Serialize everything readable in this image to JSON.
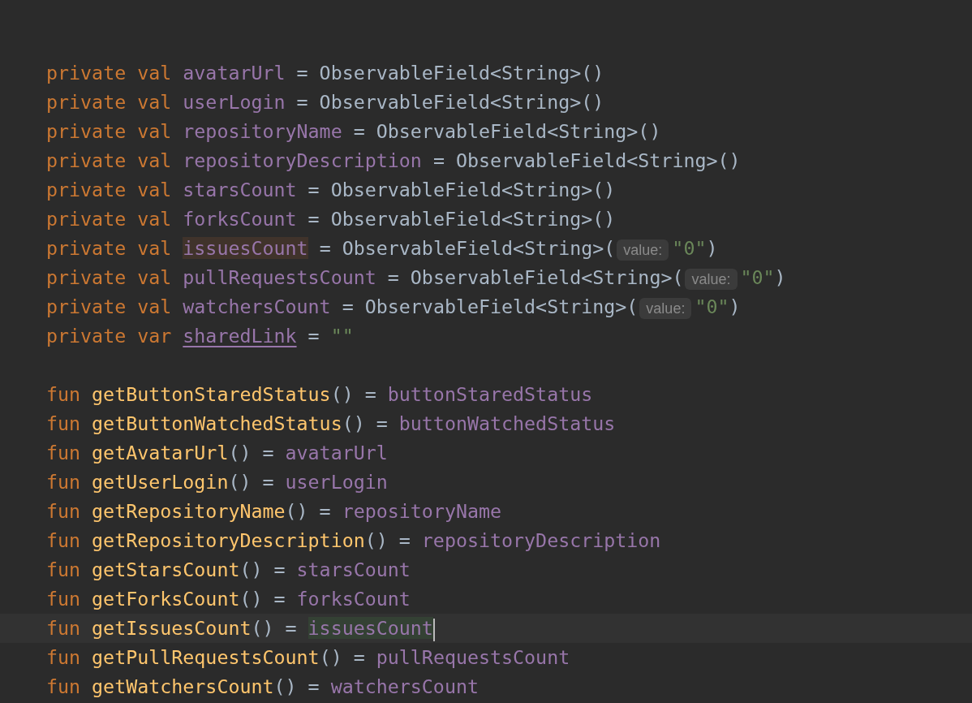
{
  "editor": {
    "blocks": [
      {
        "lines": [
          {
            "cursor": false,
            "tokens": [
              {
                "kind": "keyword",
                "t": "private val"
              },
              {
                "kind": "property",
                "t": "avatarUrl"
              },
              {
                "kind": "plain",
                "t": "= ObservableField<String>()"
              }
            ]
          },
          {
            "cursor": false,
            "tokens": [
              {
                "kind": "keyword",
                "t": "private val"
              },
              {
                "kind": "property",
                "t": "userLogin"
              },
              {
                "kind": "plain",
                "t": "= ObservableField<String>()"
              }
            ]
          },
          {
            "cursor": false,
            "tokens": [
              {
                "kind": "keyword",
                "t": "private val"
              },
              {
                "kind": "property",
                "t": "repositoryName"
              },
              {
                "kind": "plain",
                "t": "= ObservableField<String>()"
              }
            ]
          },
          {
            "cursor": false,
            "tokens": [
              {
                "kind": "keyword",
                "t": "private val"
              },
              {
                "kind": "property",
                "t": "repositoryDescription"
              },
              {
                "kind": "plain",
                "t": "= ObservableField<String>()"
              }
            ]
          },
          {
            "cursor": false,
            "tokens": [
              {
                "kind": "keyword",
                "t": "private val"
              },
              {
                "kind": "property",
                "t": "starsCount"
              },
              {
                "kind": "plain",
                "t": "= ObservableField<String>()"
              }
            ]
          },
          {
            "cursor": false,
            "tokens": [
              {
                "kind": "keyword",
                "t": "private val"
              },
              {
                "kind": "property",
                "t": "forksCount"
              },
              {
                "kind": "plain",
                "t": "= ObservableField<String>()"
              }
            ]
          },
          {
            "cursor": false,
            "tokens": [
              {
                "kind": "keyword",
                "t": "private val"
              },
              {
                "kind": "property",
                "t": "issuesCount",
                "highlighted": true
              },
              {
                "kind": "plain",
                "t": "= ObservableField<String>("
              },
              {
                "kind": "hint",
                "t": "value:"
              },
              {
                "kind": "string",
                "t": "\"0\""
              },
              {
                "kind": "plain",
                "t": ")"
              }
            ]
          },
          {
            "cursor": false,
            "tokens": [
              {
                "kind": "keyword",
                "t": "private val"
              },
              {
                "kind": "property",
                "t": "pullRequestsCount"
              },
              {
                "kind": "plain",
                "t": "= ObservableField<String>("
              },
              {
                "kind": "hint",
                "t": "value:"
              },
              {
                "kind": "string",
                "t": "\"0\""
              },
              {
                "kind": "plain",
                "t": ")"
              }
            ]
          },
          {
            "cursor": false,
            "tokens": [
              {
                "kind": "keyword",
                "t": "private val"
              },
              {
                "kind": "property",
                "t": "watchersCount"
              },
              {
                "kind": "plain",
                "t": "= ObservableField<String>("
              },
              {
                "kind": "hint",
                "t": "value:"
              },
              {
                "kind": "string",
                "t": "\"0\""
              },
              {
                "kind": "plain",
                "t": ")"
              }
            ]
          },
          {
            "cursor": false,
            "tokens": [
              {
                "kind": "keyword",
                "t": "private var"
              },
              {
                "kind": "var_property",
                "t": "sharedLink"
              },
              {
                "kind": "plain",
                "t": "="
              },
              {
                "kind": "string",
                "t": "\"\""
              }
            ]
          }
        ]
      },
      {
        "lines": [
          {
            "cursor": false,
            "tokens": [
              {
                "kind": "keyword",
                "t": "fun"
              },
              {
                "kind": "function",
                "t": "getButtonStaredStatus"
              },
              {
                "kind": "plain",
                "t": "() ="
              },
              {
                "kind": "property",
                "t": "buttonStaredStatus"
              }
            ]
          },
          {
            "cursor": false,
            "tokens": [
              {
                "kind": "keyword",
                "t": "fun"
              },
              {
                "kind": "function",
                "t": "getButtonWatchedStatus"
              },
              {
                "kind": "plain",
                "t": "() ="
              },
              {
                "kind": "property",
                "t": "buttonWatchedStatus"
              }
            ]
          },
          {
            "cursor": false,
            "tokens": [
              {
                "kind": "keyword",
                "t": "fun"
              },
              {
                "kind": "function",
                "t": "getAvatarUrl"
              },
              {
                "kind": "plain",
                "t": "() ="
              },
              {
                "kind": "property",
                "t": "avatarUrl"
              }
            ]
          },
          {
            "cursor": false,
            "tokens": [
              {
                "kind": "keyword",
                "t": "fun"
              },
              {
                "kind": "function",
                "t": "getUserLogin"
              },
              {
                "kind": "plain",
                "t": "() ="
              },
              {
                "kind": "property",
                "t": "userLogin"
              }
            ]
          },
          {
            "cursor": false,
            "tokens": [
              {
                "kind": "keyword",
                "t": "fun"
              },
              {
                "kind": "function",
                "t": "getRepositoryName"
              },
              {
                "kind": "plain",
                "t": "() ="
              },
              {
                "kind": "property",
                "t": "repositoryName"
              }
            ]
          },
          {
            "cursor": false,
            "tokens": [
              {
                "kind": "keyword",
                "t": "fun"
              },
              {
                "kind": "function",
                "t": "getRepositoryDescription"
              },
              {
                "kind": "plain",
                "t": "() ="
              },
              {
                "kind": "property",
                "t": "repositoryDescription"
              }
            ]
          },
          {
            "cursor": false,
            "tokens": [
              {
                "kind": "keyword",
                "t": "fun"
              },
              {
                "kind": "function",
                "t": "getStarsCount"
              },
              {
                "kind": "plain",
                "t": "() ="
              },
              {
                "kind": "property",
                "t": "starsCount"
              }
            ]
          },
          {
            "cursor": false,
            "tokens": [
              {
                "kind": "keyword",
                "t": "fun"
              },
              {
                "kind": "function",
                "t": "getForksCount"
              },
              {
                "kind": "plain",
                "t": "() ="
              },
              {
                "kind": "property",
                "t": "forksCount"
              }
            ]
          },
          {
            "cursor": true,
            "tokens": [
              {
                "kind": "keyword",
                "t": "fun"
              },
              {
                "kind": "function",
                "t": "getIssuesCount"
              },
              {
                "kind": "plain",
                "t": "() ="
              },
              {
                "kind": "property",
                "t": "issuesCount",
                "highlighted": true
              }
            ]
          },
          {
            "cursor": false,
            "tokens": [
              {
                "kind": "keyword",
                "t": "fun"
              },
              {
                "kind": "function",
                "t": "getPullRequestsCount"
              },
              {
                "kind": "plain",
                "t": "() ="
              },
              {
                "kind": "property",
                "t": "pullRequestsCount"
              }
            ]
          },
          {
            "cursor": false,
            "tokens": [
              {
                "kind": "keyword",
                "t": "fun"
              },
              {
                "kind": "function",
                "t": "getWatchersCount"
              },
              {
                "kind": "plain",
                "t": "() ="
              },
              {
                "kind": "property",
                "t": "watchersCount"
              }
            ]
          }
        ]
      }
    ]
  }
}
